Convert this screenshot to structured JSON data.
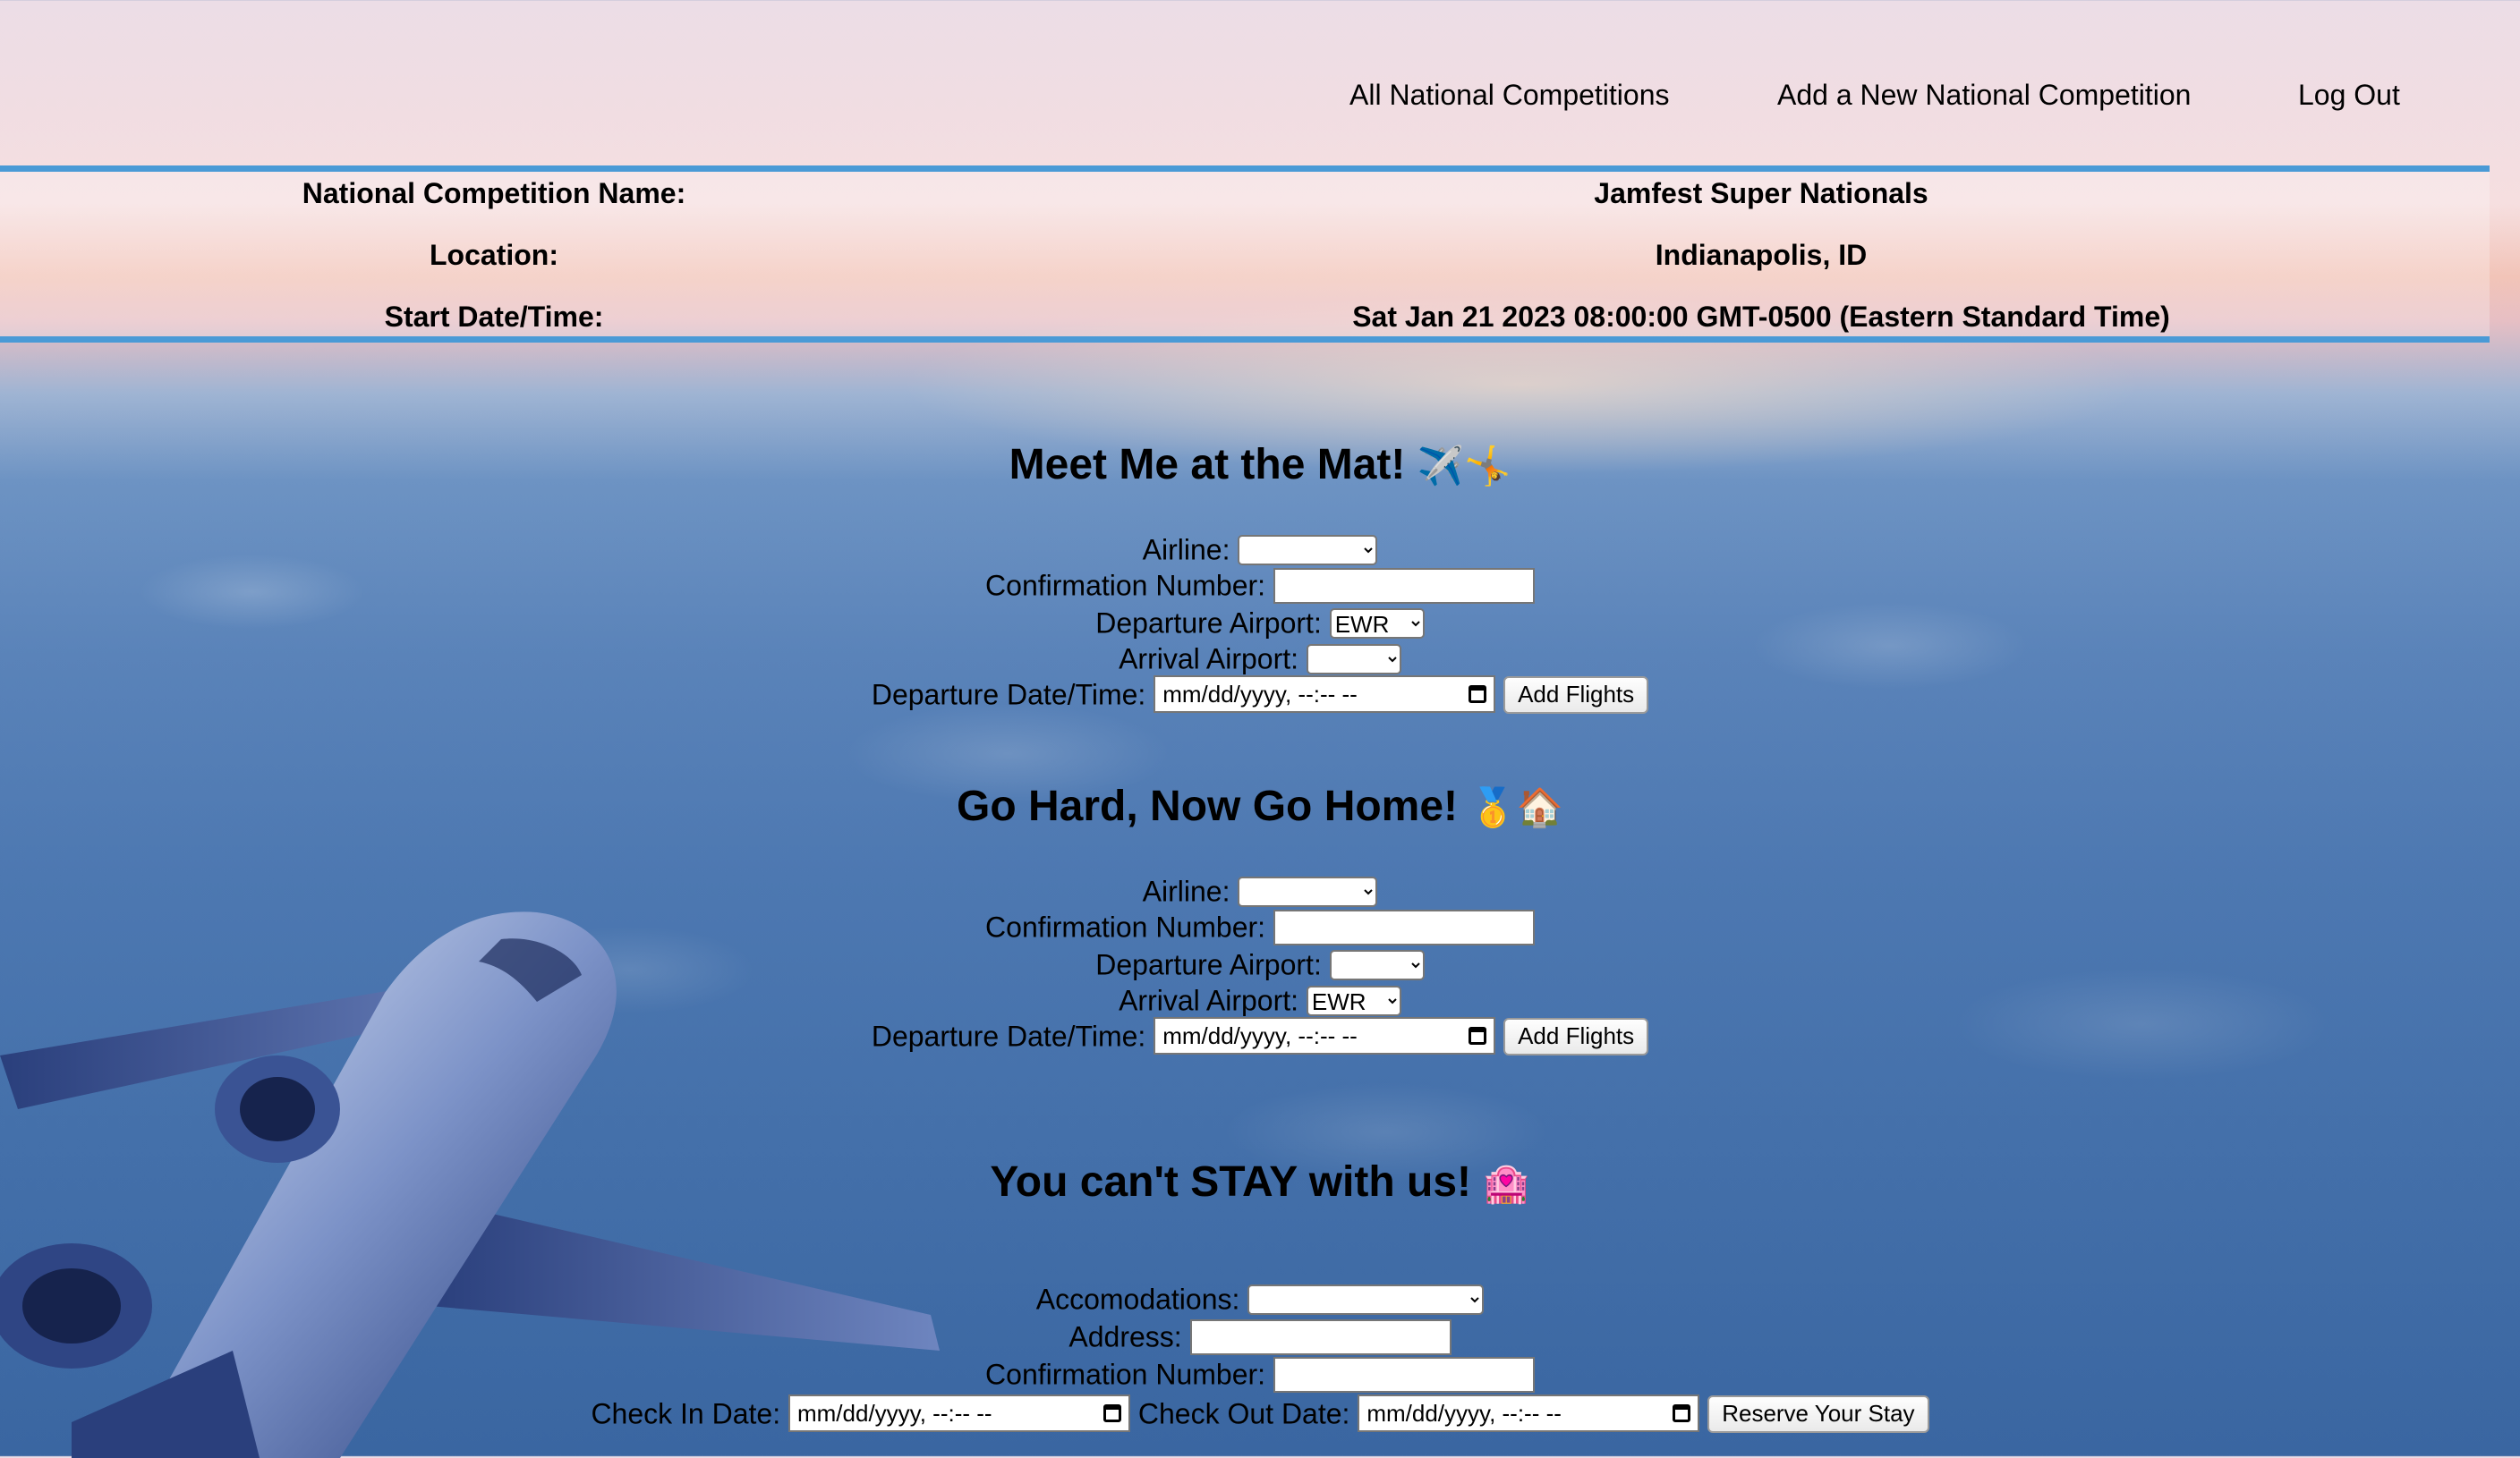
{
  "nav": {
    "all_label": "All National Competitions",
    "add_label": "Add a New National Competition",
    "logout_label": "Log Out"
  },
  "competition": {
    "name_label": "National Competition Name:",
    "name_value": "Jamfest Super Nationals",
    "location_label": "Location:",
    "location_value": "Indianapolis, ID",
    "start_label": "Start Date/Time:",
    "start_value": "Sat Jan 21 2023 08:00:00 GMT-0500 (Eastern Standard Time)"
  },
  "flight_out": {
    "heading": "Meet Me at the Mat!",
    "heading_emoji": "✈️🤸",
    "airline_label": "Airline:",
    "airline_value": "",
    "confirmation_label": "Confirmation Number:",
    "confirmation_value": "",
    "departure_airport_label": "Departure Airport:",
    "departure_airport_value": "EWR",
    "arrival_airport_label": "Arrival Airport:",
    "arrival_airport_value": "",
    "departure_dt_label": "Departure Date/Time:",
    "departure_dt_placeholder": "mm/dd/yyyy, --:-- --",
    "button_label": "Add Flights"
  },
  "flight_home": {
    "heading": "Go Hard, Now Go Home!",
    "heading_emoji": "🥇🏠",
    "airline_label": "Airline:",
    "airline_value": "",
    "confirmation_label": "Confirmation Number:",
    "confirmation_value": "",
    "departure_airport_label": "Departure Airport:",
    "departure_airport_value": "",
    "arrival_airport_label": "Arrival Airport:",
    "arrival_airport_value": "EWR",
    "departure_dt_label": "Departure Date/Time:",
    "departure_dt_placeholder": "mm/dd/yyyy, --:-- --",
    "button_label": "Add Flights"
  },
  "stay": {
    "heading": "You can't STAY with us!",
    "heading_emoji": "🏩",
    "accommodations_label": "Accomodations:",
    "accommodations_value": "",
    "address_label": "Address:",
    "address_value": "",
    "confirmation_label": "Confirmation Number:",
    "confirmation_value": "",
    "checkin_label": "Check In Date:",
    "checkin_placeholder": "mm/dd/yyyy, --:-- --",
    "checkout_label": "Check Out Date:",
    "checkout_placeholder": "mm/dd/yyyy, --:-- --",
    "button_label": "Reserve Your Stay"
  },
  "colors": {
    "divider": "#4a9ad6",
    "sky_top": "#ecdde6",
    "sky_bottom": "#3a66a1"
  }
}
